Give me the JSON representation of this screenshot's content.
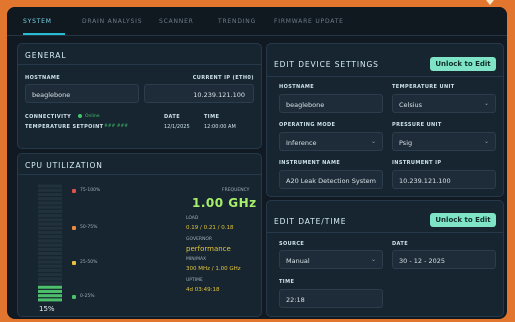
{
  "tabs": [
    {
      "label": "System"
    },
    {
      "label": "Drain Analysis"
    },
    {
      "label": "Scanner"
    },
    {
      "label": "Trending"
    },
    {
      "label": "Firmware Update"
    }
  ],
  "general": {
    "title": "General",
    "hostname_label": "Hostname",
    "hostname_value": "beaglebone",
    "ip_label": "Current IP (eth0)",
    "ip_value": "10.239.121.100",
    "connectivity_label": "Connectivity",
    "connectivity_value": "Online",
    "temp_label": "Temperature Setpoint",
    "temp_value": "### ###",
    "date_label": "Date",
    "date_value": "12/1/2025",
    "time_label": "Time",
    "time_value": "12:00:00 AM"
  },
  "cpu": {
    "title": "CPU Utilization",
    "percent": "15%",
    "usage_fraction": 0.15,
    "legend": [
      {
        "label": "75-100%",
        "color": "#e0504a"
      },
      {
        "label": "50-75%",
        "color": "#e88a3a"
      },
      {
        "label": "25-50%",
        "color": "#e8c23a"
      },
      {
        "label": "0-25%",
        "color": "#4bbf6a"
      }
    ],
    "frequency_label": "Frequency",
    "frequency_value": "1.00 GHz",
    "load_label": "Load",
    "load_value": "0.19 / 0.21 / 0.18",
    "governor_label": "Governor",
    "governor_value": "performance",
    "minmax_label": "Min/Max",
    "minmax_value": "300 MHz / 1.00 GHz",
    "uptime_label": "Uptime",
    "uptime_value": "4d 03:49:18"
  },
  "device": {
    "title": "Edit Device Settings",
    "unlock": "Unlock to Edit",
    "hostname_label": "Hostname",
    "hostname_value": "beaglebone",
    "temp_unit_label": "Temperature Unit",
    "temp_unit_value": "Celsius",
    "mode_label": "Operating Mode",
    "mode_value": "Inference",
    "pressure_label": "Pressure Unit",
    "pressure_value": "Psig",
    "instrument_label": "Instrument Name",
    "instrument_value": "A20 Leak Detection System",
    "instrument_ip_label": "Instrument IP",
    "instrument_ip_value": "10.239.121.100"
  },
  "datetime": {
    "title": "Edit Date/Time",
    "unlock": "Unlock to Edit",
    "source_label": "Source",
    "source_value": "Manual",
    "date_label": "Date",
    "date_value": "30 - 12 - 2025",
    "time_label": "Time",
    "time_value": "22:18"
  },
  "colors": {
    "accent": "#27bcd6",
    "unlock_button": "#7fe3c6",
    "yellow_value": "#e3c53a",
    "online": "#41c46a"
  }
}
